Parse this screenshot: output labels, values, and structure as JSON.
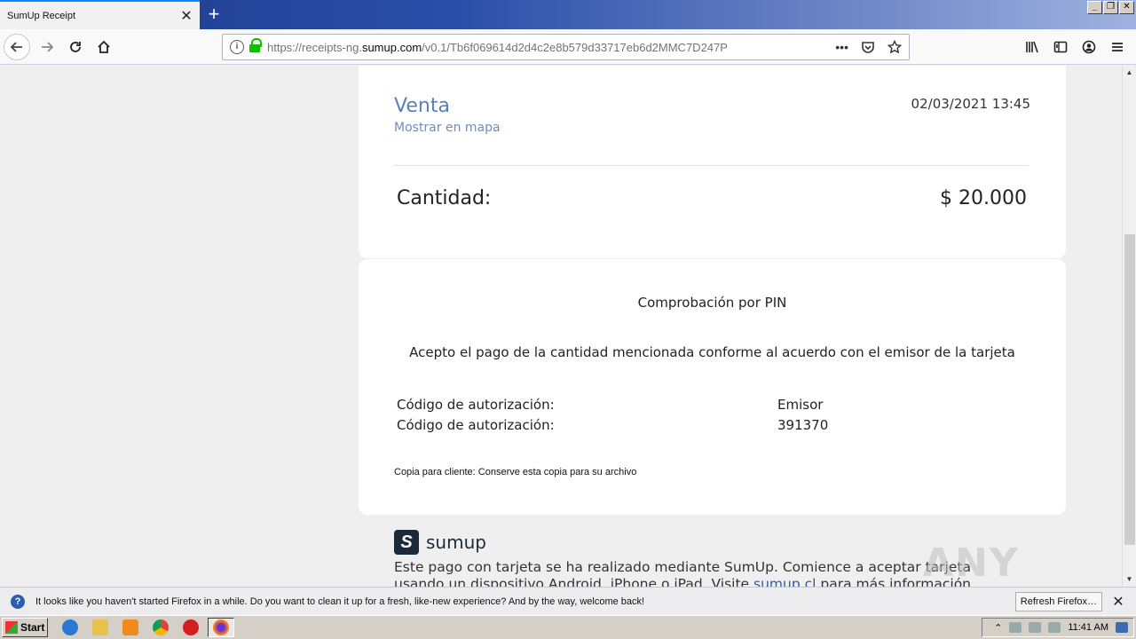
{
  "browser": {
    "tab_title": "SumUp Receipt",
    "tab_close": "✕",
    "new_tab": "+",
    "url_prefix": "https://receipts-ng.",
    "url_domain": "sumup.com",
    "url_path": "/v0.1/Tb6f069614d2d4c2e8b579d33717eb6d2MMC7D247P",
    "more_icon": "•••"
  },
  "receipt": {
    "title": "Venta",
    "map_link": "Mostrar en mapa",
    "datetime": "02/03/2021 13:45",
    "amount_label": "Cantidad:",
    "amount_value": "$ 20.000"
  },
  "verification": {
    "method": "Comprobación por PIN",
    "agreement": "Acepto el pago de la cantidad mencionada conforme al acuerdo con el emisor de la tarjeta",
    "rows": [
      {
        "label": "Código de autorización:",
        "value": "Emisor"
      },
      {
        "label": "Código de autorización:",
        "value": "391370"
      }
    ],
    "copy_note": "Copia para cliente: Conserve esta copia para su archivo"
  },
  "footer": {
    "brand": "sumup",
    "brand_mark": "S",
    "text_before_link": "Este pago con tarjeta se ha realizado mediante SumUp. Comience a aceptar tarjeta usando un dispositivo Android, iPhone o iPad. Visite ",
    "link": "sumup.cl",
    "text_after_link": " para más información."
  },
  "watermark": "ANY RUN",
  "notification": {
    "icon": "?",
    "message": "It looks like you haven't started Firefox in a while. Do you want to clean it up for a fresh, like-new experience? And by the way, welcome back!",
    "button": "Refresh Firefox…",
    "close": "✕"
  },
  "taskbar": {
    "start": "Start",
    "clock": "11:41 AM"
  }
}
